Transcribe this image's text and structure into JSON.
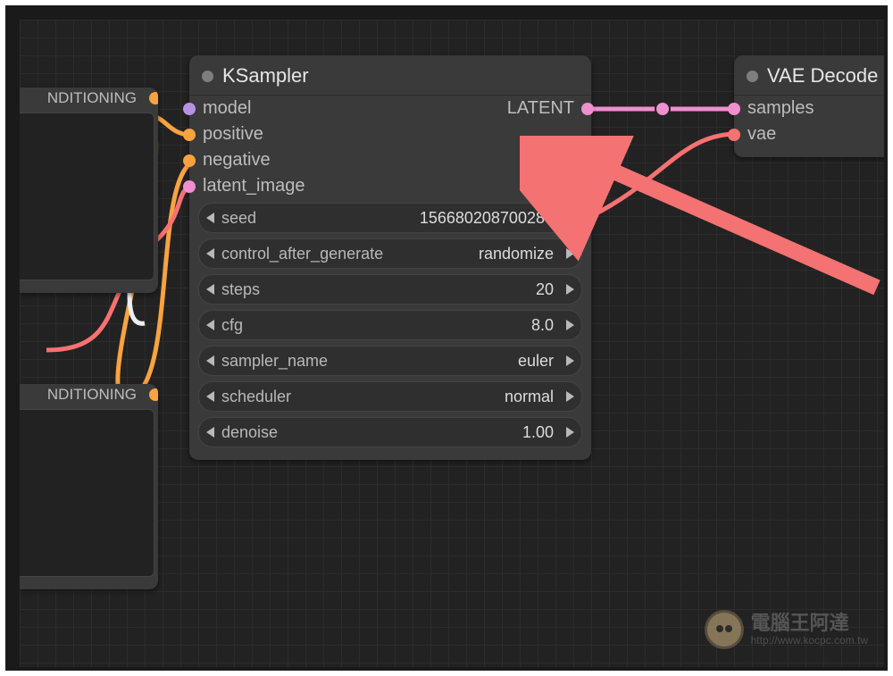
{
  "stub_top": {
    "output_label": "NDITIONING"
  },
  "stub_bottom": {
    "output_label": "NDITIONING"
  },
  "ksampler": {
    "title": "KSampler",
    "inputs": {
      "model": "model",
      "positive": "positive",
      "negative": "negative",
      "latent_image": "latent_image"
    },
    "outputs": {
      "latent": "LATENT"
    },
    "widgets": {
      "seed": {
        "label": "seed",
        "value": "156680208700286"
      },
      "control_after_generate": {
        "label": "control_after_generate",
        "value": "randomize"
      },
      "steps": {
        "label": "steps",
        "value": "20"
      },
      "cfg": {
        "label": "cfg",
        "value": "8.0"
      },
      "sampler_name": {
        "label": "sampler_name",
        "value": "euler"
      },
      "scheduler": {
        "label": "scheduler",
        "value": "normal"
      },
      "denoise": {
        "label": "denoise",
        "value": "1.00"
      }
    }
  },
  "vae_decode": {
    "title": "VAE Decode",
    "inputs": {
      "samples": "samples",
      "vae": "vae"
    }
  },
  "watermark": {
    "title": "電腦王阿達",
    "url": "http://www.kocpc.com.tw"
  }
}
